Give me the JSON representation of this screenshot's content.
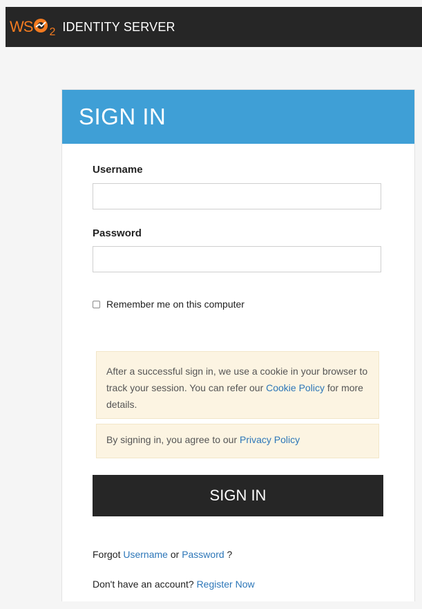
{
  "brand": {
    "logo_ws": "WS",
    "logo_2": "2",
    "product": "IDENTITY SERVER",
    "accent_color": "#f47b20"
  },
  "card": {
    "title": "SIGN IN",
    "header_color": "#3f9fd6"
  },
  "username": {
    "label": "Username",
    "value": "",
    "placeholder": ""
  },
  "password": {
    "label": "Password",
    "value": "",
    "placeholder": ""
  },
  "remember": {
    "label": "Remember me on this computer",
    "checked": false
  },
  "cookie_notice": {
    "text_before": "After a successful sign in, we use a cookie in your browser to track your session. You can refer our",
    "link": "Cookie Policy",
    "text_after": "for more details."
  },
  "privacy_notice": {
    "text_before": "By signing in, you agree to our",
    "link": "Privacy Policy"
  },
  "signin_button": {
    "label": "SIGN IN"
  },
  "forgot": {
    "prefix": "Forgot",
    "username_link": "Username",
    "or": "or",
    "password_link": "Password",
    "suffix": "?"
  },
  "register": {
    "prefix": "Don't have an account?",
    "link": "Register Now"
  },
  "icons": {
    "logo_mark": "wso2-logo-icon",
    "checkbox": "checkbox-icon"
  }
}
